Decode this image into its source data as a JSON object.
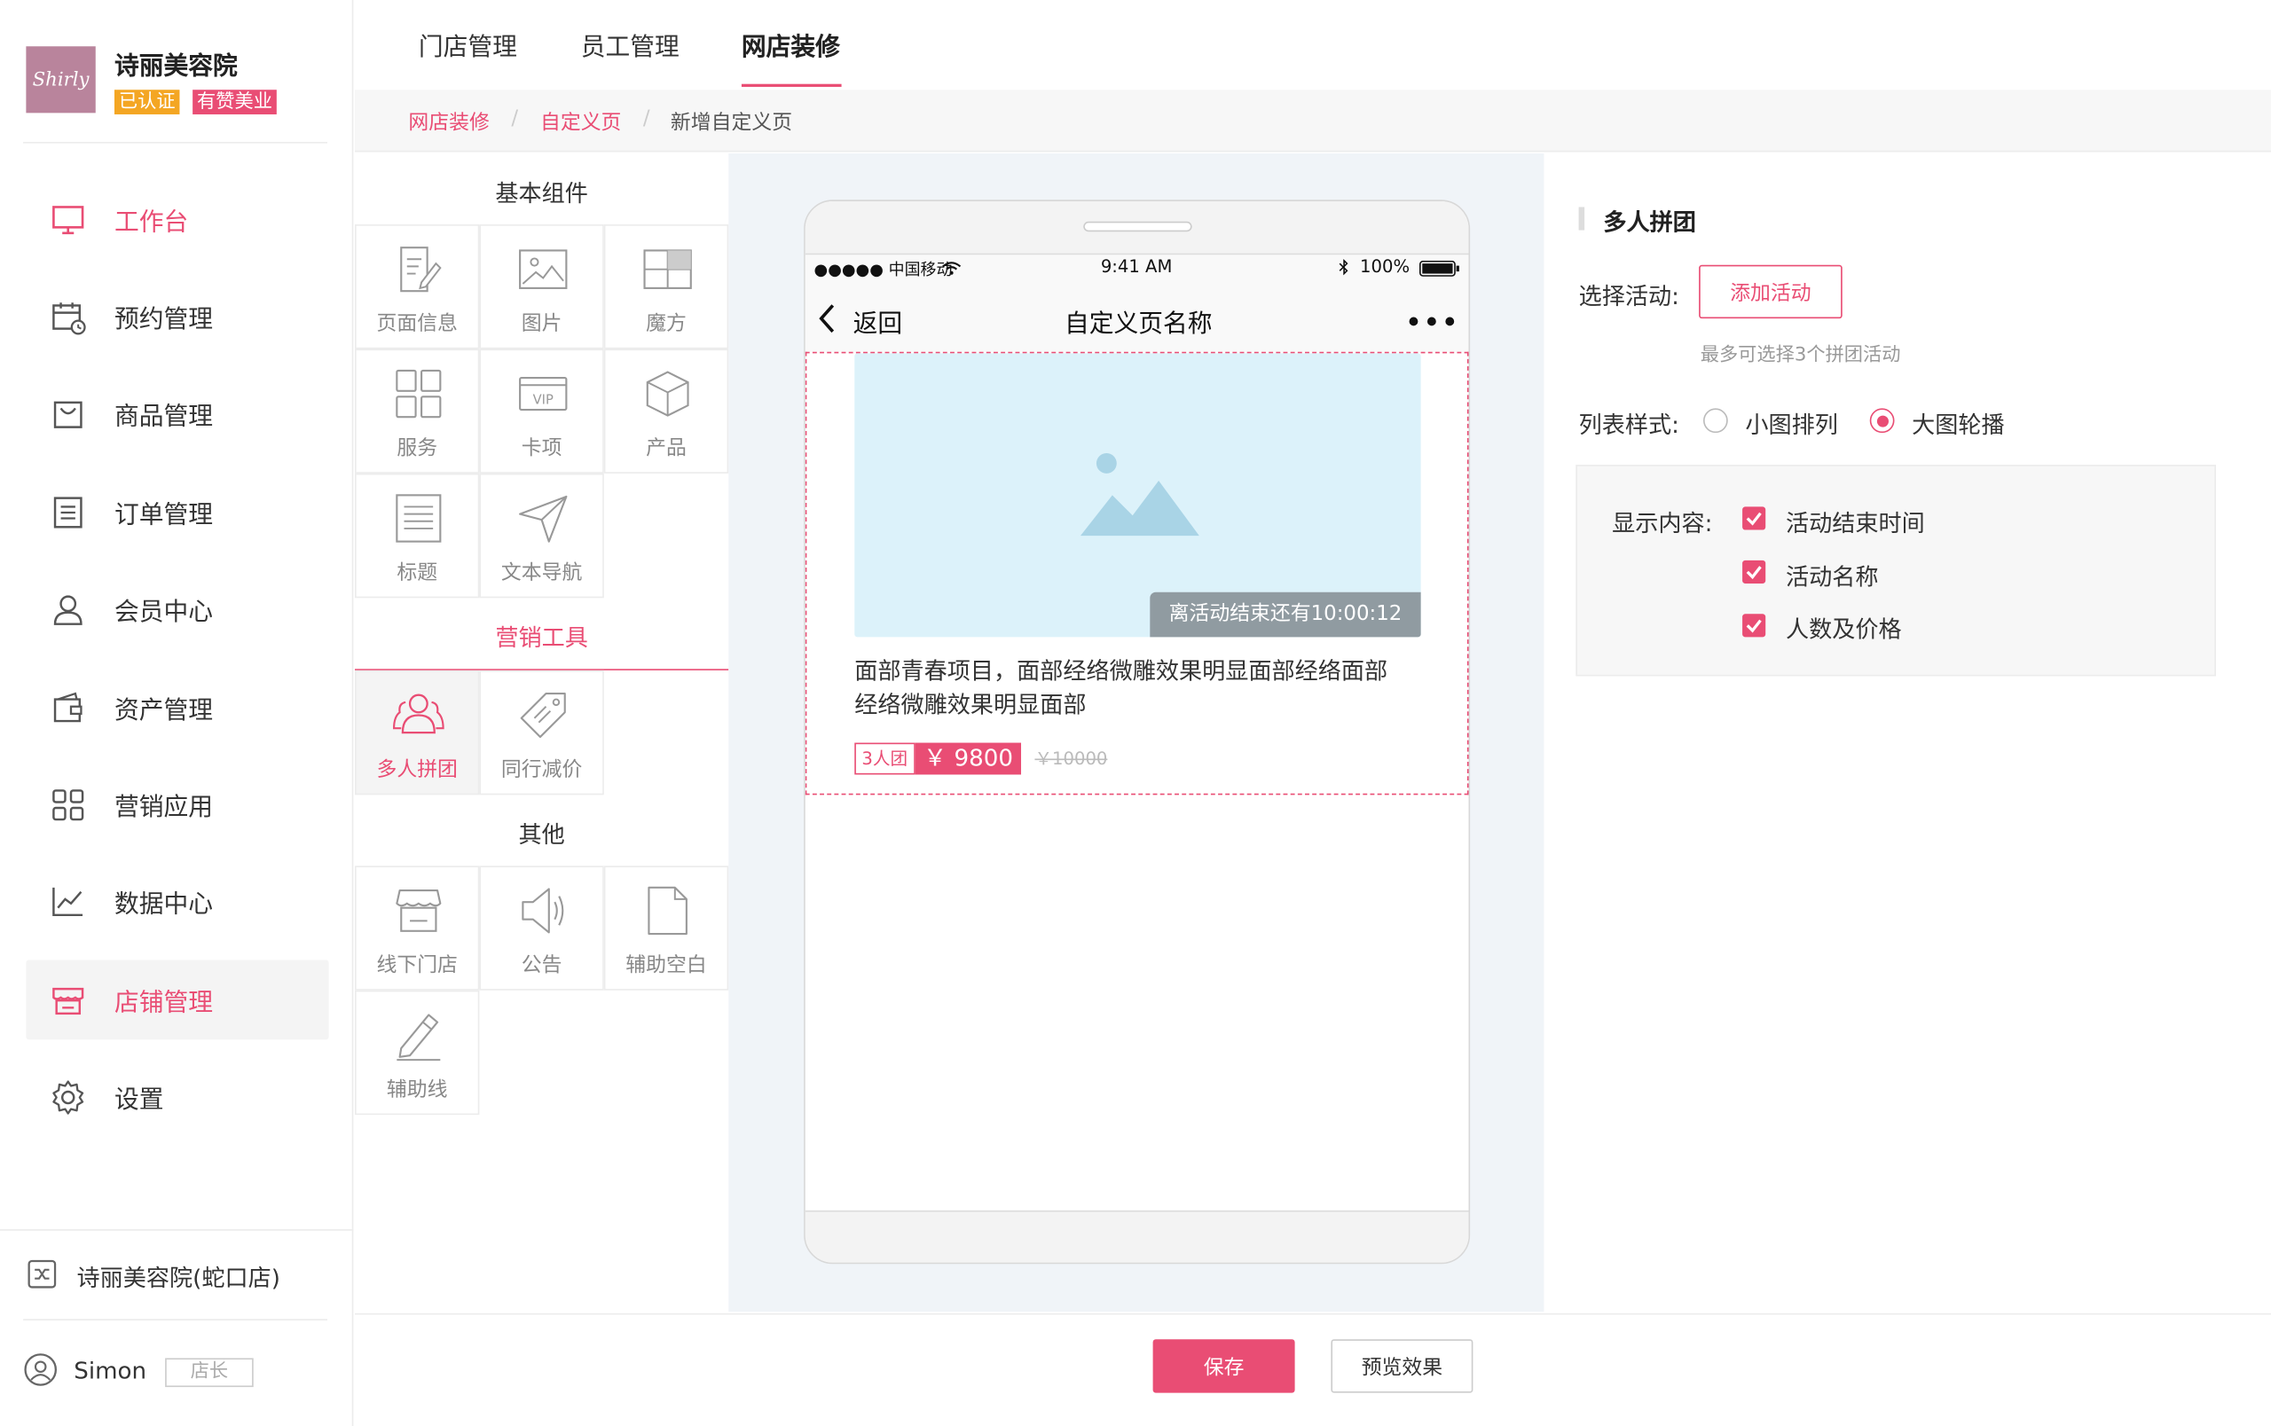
{
  "brand": {
    "logo_text": "Shirly",
    "name": "诗丽美容院",
    "badge_certified": "已认证",
    "badge_partner": "有赞美业",
    "colors": {
      "accent": "#e94d74",
      "certified": "#f4a623",
      "logo_bg": "#b9849c"
    }
  },
  "sidebar": {
    "items": [
      {
        "label": "工作台",
        "icon": "monitor-icon"
      },
      {
        "label": "预约管理",
        "icon": "calendar-clock-icon"
      },
      {
        "label": "商品管理",
        "icon": "shopping-bag-icon"
      },
      {
        "label": "订单管理",
        "icon": "order-list-icon"
      },
      {
        "label": "会员中心",
        "icon": "user-icon"
      },
      {
        "label": "资产管理",
        "icon": "wallet-icon"
      },
      {
        "label": "营销应用",
        "icon": "grid-apps-icon"
      },
      {
        "label": "数据中心",
        "icon": "chart-line-icon"
      },
      {
        "label": "店铺管理",
        "icon": "store-icon"
      },
      {
        "label": "设置",
        "icon": "gear-icon"
      }
    ],
    "store_switch": "诗丽美容院(蛇口店)",
    "user_name": "Simon",
    "user_role": "店长"
  },
  "top_tabs": [
    "门店管理",
    "员工管理",
    "网店装修"
  ],
  "breadcrumb": [
    "网店装修",
    "自定义页",
    "新增自定义页"
  ],
  "components": {
    "basic_title": "基本组件",
    "basic": [
      {
        "label": "页面信息",
        "icon": "page-edit-icon"
      },
      {
        "label": "图片",
        "icon": "image-icon"
      },
      {
        "label": "魔方",
        "icon": "cube-layout-icon"
      },
      {
        "label": "服务",
        "icon": "grid-four-icon"
      },
      {
        "label": "卡项",
        "icon": "vip-card-icon"
      },
      {
        "label": "产品",
        "icon": "product-box-icon"
      },
      {
        "label": "标题",
        "icon": "title-lines-icon"
      },
      {
        "label": "文本导航",
        "icon": "send-icon"
      }
    ],
    "marketing_title": "营销工具",
    "marketing": [
      {
        "label": "多人拼团",
        "icon": "group-users-icon"
      },
      {
        "label": "同行减价",
        "icon": "price-tag-icon"
      }
    ],
    "other_title": "其他",
    "other": [
      {
        "label": "线下门店",
        "icon": "shop-icon"
      },
      {
        "label": "公告",
        "icon": "speaker-icon"
      },
      {
        "label": "辅助空白",
        "icon": "blank-doc-icon"
      },
      {
        "label": "辅助线",
        "icon": "pencil-icon"
      }
    ]
  },
  "phone": {
    "carrier": "●●●●● 中国移动",
    "time": "9:41 AM",
    "battery": "100%",
    "back": "返回",
    "page_title": "自定义页名称",
    "countdown": "离活动结束还有10:00:12",
    "item_title": "面部青春项目，面部经络微雕效果明显面部经络面部经络微雕效果明显面部",
    "group_tag": "3人团",
    "price": "￥ 9800",
    "orig_price": "￥10000"
  },
  "settings": {
    "title": "多人拼团",
    "select_label": "选择活动:",
    "add_button": "添加活动",
    "hint": "最多可选择3个拼团活动",
    "style_label": "列表样式:",
    "style_options": [
      "小图排列",
      "大图轮播"
    ],
    "style_selected": "大图轮播",
    "display_label": "显示内容:",
    "display_options": [
      "活动结束时间",
      "活动名称",
      "人数及价格"
    ]
  },
  "footer": {
    "save": "保存",
    "preview": "预览效果"
  }
}
